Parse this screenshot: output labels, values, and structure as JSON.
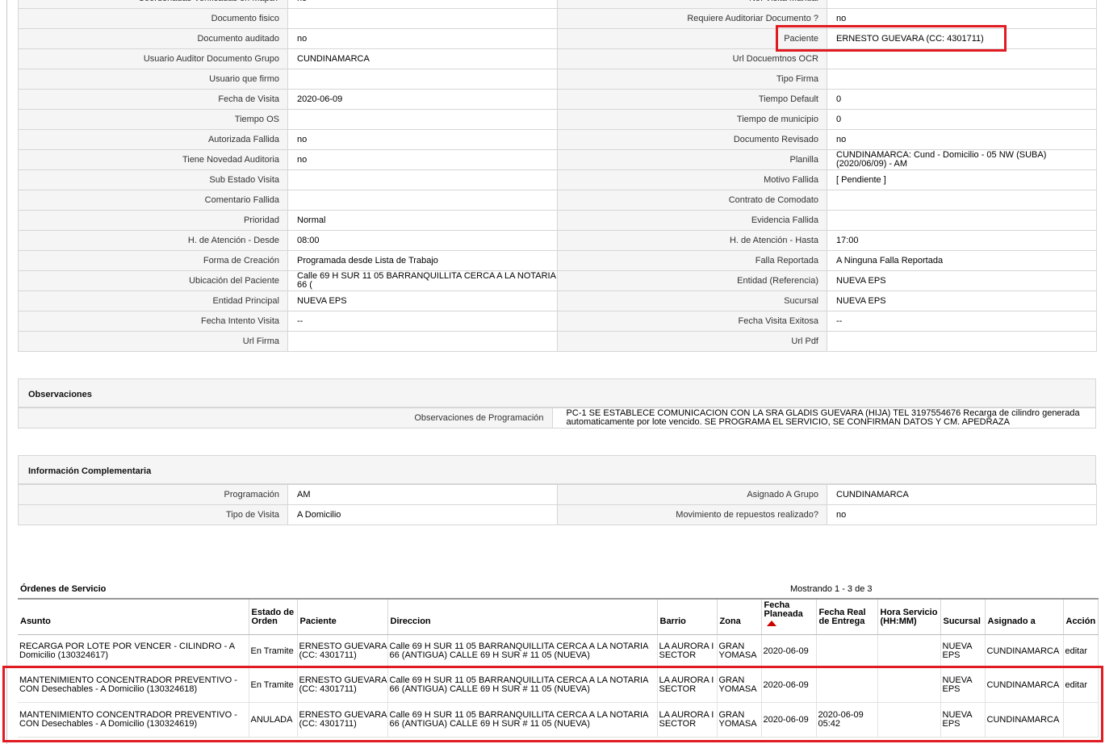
{
  "top_cut": {
    "left_label": "Coordenadas Verificadas en Mapa?",
    "left_value": "no",
    "right_label": "No. Visita Manual"
  },
  "details": [
    {
      "l1": "Documento fisico",
      "v1": "",
      "l2": "Requiere Auditoriar Documento ?",
      "v2": "no"
    },
    {
      "l1": "Documento auditado",
      "v1": "no",
      "l2": "Paciente",
      "v2": "ERNESTO GUEVARA (CC: 4301711)"
    },
    {
      "l1": "Usuario Auditor Documento Grupo",
      "v1": "CUNDINAMARCA",
      "l2": "Url Docuemtnos OCR",
      "v2": ""
    },
    {
      "l1": "Usuario que firmo",
      "v1": "",
      "l2": "Tipo Firma",
      "v2": ""
    },
    {
      "l1": "Fecha de Visita",
      "v1": "2020-06-09",
      "l2": "Tiempo Default",
      "v2": "0"
    },
    {
      "l1": "Tiempo OS",
      "v1": "",
      "l2": "Tiempo de municipio",
      "v2": "0"
    },
    {
      "l1": "Autorizada Fallida",
      "v1": "no",
      "l2": "Documento Revisado",
      "v2": "no"
    },
    {
      "l1": "Tiene Novedad Auditoria",
      "v1": "no",
      "l2": "Planilla",
      "v2": "CUNDINAMARCA: Cund - Domicilio - 05 NW (SUBA) (2020/06/09) - AM"
    },
    {
      "l1": "Sub Estado Visita",
      "v1": "",
      "l2": "Motivo Fallida",
      "v2": "[ Pendiente ]"
    },
    {
      "l1": "Comentario Fallida",
      "v1": "",
      "l2": "Contrato de Comodato",
      "v2": ""
    },
    {
      "l1": "Prioridad",
      "v1": "Normal",
      "l2": "Evidencia Fallida",
      "v2": ""
    },
    {
      "l1": "H. de Atención - Desde",
      "v1": "08:00",
      "l2": "H. de Atención - Hasta",
      "v2": "17:00"
    },
    {
      "l1": "Forma de Creación",
      "v1": "Programada desde Lista de Trabajo",
      "l2": "Falla Reportada",
      "v2": "A Ninguna Falla Reportada"
    },
    {
      "l1": "Ubicación del Paciente",
      "v1": "Calle 69 H SUR 11 05 BARRANQUILLITA CERCA A LA NOTARIA 66 (",
      "l2": "Entidad (Referencia)",
      "v2": "NUEVA EPS"
    },
    {
      "l1": "Entidad Principal",
      "v1": "NUEVA EPS",
      "l2": "Sucursal",
      "v2": "NUEVA EPS"
    },
    {
      "l1": "Fecha Intento Visita",
      "v1": "--",
      "l2": "Fecha Visita Exitosa",
      "v2": "--"
    },
    {
      "l1": "Url Firma",
      "v1": "",
      "l2": "Url Pdf",
      "v2": ""
    }
  ],
  "observaciones": {
    "title": "Observaciones",
    "label": "Observaciones de Programación",
    "value": "PC-1 SE ESTABLECE COMUNICACION CON LA SRA GLADIS GUEVARA (HIJA) TEL 3197554676 Recarga de cilindro generada automaticamente por lote vencido. SE PROGRAMA EL SERVICIO, SE CONFIRMAN DATOS Y CM. APEDRAZA"
  },
  "complementaria": {
    "title": "Información Complementaria",
    "rows": [
      {
        "l1": "Programación",
        "v1": "AM",
        "l2": "Asignado A Grupo",
        "v2": "CUNDINAMARCA"
      },
      {
        "l1": "Tipo de Visita",
        "v1": "A Domicilio",
        "l2": "Movimiento de repuestos realizado?",
        "v2": "no"
      }
    ]
  },
  "orders": {
    "title": "Órdenes de Servicio",
    "count_text": "Mostrando 1 - 3 de 3",
    "headers": [
      "Asunto",
      "Estado de Orden",
      "Paciente",
      "Direccion",
      "Barrio",
      "Zona",
      "Fecha Planeada",
      "Fecha Real de Entrega",
      "Hora Servicio (HH:MM)",
      "Sucursal",
      "Asignado a",
      "Acción"
    ],
    "rows": [
      {
        "asunto": "RECARGA POR LOTE POR VENCER - CILINDRO - A Domicilio (130324617)",
        "estado": "En Tramite",
        "paciente": "ERNESTO GUEVARA (CC: 4301711)",
        "direccion": "Calle 69 H SUR 11 05 BARRANQUILLITA CERCA A LA NOTARIA 66 (ANTIGUA) CALLE 69 H SUR # 11 05 (NUEVA)",
        "barrio": "LA AURORA I SECTOR",
        "zona": "GRAN YOMASA",
        "fecha_planeada": "2020-06-09",
        "fecha_real": "",
        "hora": "",
        "sucursal": "NUEVA EPS",
        "asignado": "CUNDINAMARCA",
        "accion": "editar"
      },
      {
        "asunto": "MANTENIMIENTO CONCENTRADOR PREVENTIVO - CON Desechables - A Domicilio (130324618)",
        "estado": "En Tramite",
        "paciente": "ERNESTO GUEVARA (CC: 4301711)",
        "direccion": "Calle 69 H SUR 11 05 BARRANQUILLITA CERCA A LA NOTARIA 66 (ANTIGUA) CALLE 69 H SUR # 11 05 (NUEVA)",
        "barrio": "LA AURORA I SECTOR",
        "zona": "GRAN YOMASA",
        "fecha_planeada": "2020-06-09",
        "fecha_real": "",
        "hora": "",
        "sucursal": "NUEVA EPS",
        "asignado": "CUNDINAMARCA",
        "accion": "editar"
      },
      {
        "asunto": "MANTENIMIENTO CONCENTRADOR PREVENTIVO - CON Desechables - A Domicilio (130324619)",
        "estado": "ANULADA",
        "paciente": "ERNESTO GUEVARA (CC: 4301711)",
        "direccion": "Calle 69 H SUR 11 05 BARRANQUILLITA CERCA A LA NOTARIA 66 (ANTIGUA) CALLE 69 H SUR # 11 05 (NUEVA)",
        "barrio": "LA AURORA I SECTOR",
        "zona": "GRAN YOMASA",
        "fecha_planeada": "2020-06-09",
        "fecha_real": "2020-06-09 05:42",
        "hora": "",
        "sucursal": "NUEVA EPS",
        "asignado": "CUNDINAMARCA",
        "accion": ""
      }
    ]
  },
  "colors": {
    "highlight": "#e11b22",
    "label_bg": "#f5f5f5",
    "sort_arrow": "#cc0000"
  }
}
